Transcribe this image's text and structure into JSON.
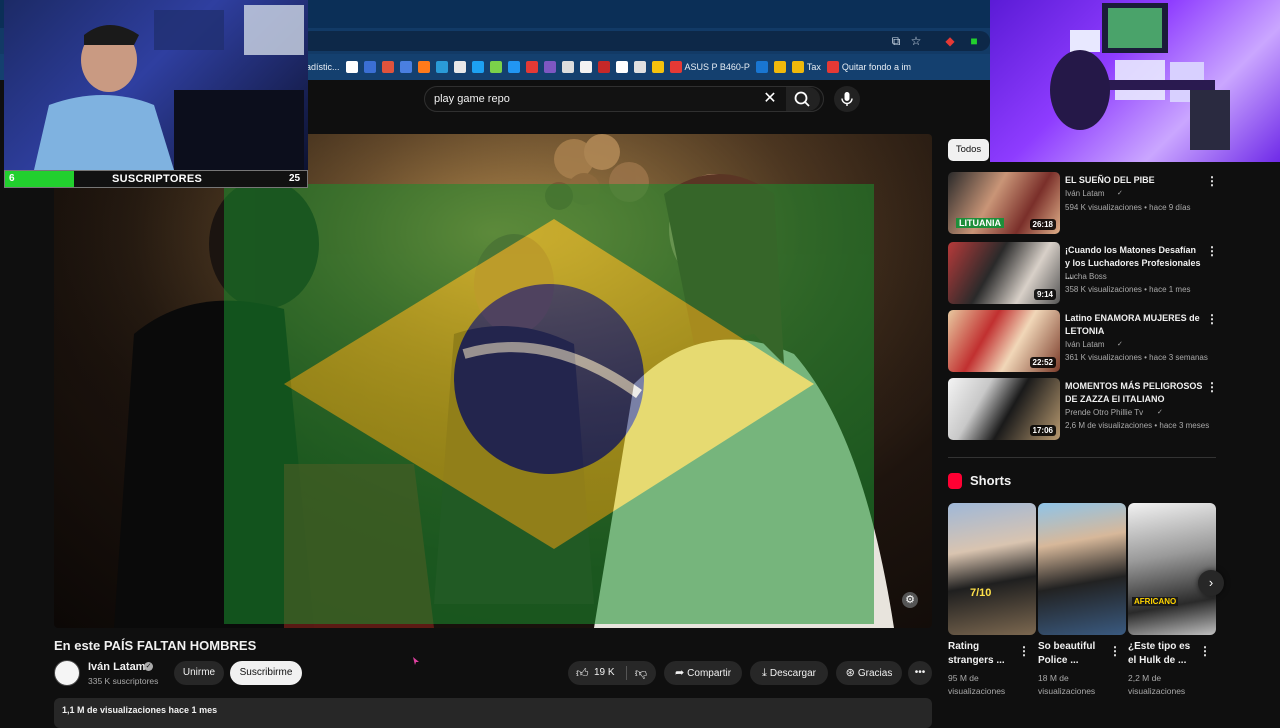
{
  "bookmarks": [
    {
      "label": "adístic...",
      "color": "#3a78d6"
    },
    {
      "label": "",
      "color": "#ffffff"
    },
    {
      "label": "",
      "color": "#3b6fd4"
    },
    {
      "label": "",
      "color": "#e0533c"
    },
    {
      "label": "",
      "color": "#4a7fe0"
    },
    {
      "label": "",
      "color": "#ff7a1a"
    },
    {
      "label": "",
      "color": "#2a9bd8"
    },
    {
      "label": "",
      "color": "#e8e8e8"
    },
    {
      "label": "",
      "color": "#1da1f2"
    },
    {
      "label": "",
      "color": "#7bd14a"
    },
    {
      "label": "",
      "color": "#2196f3"
    },
    {
      "label": "",
      "color": "#e53935"
    },
    {
      "label": "",
      "color": "#7e57c2"
    },
    {
      "label": "",
      "color": "#dddddd"
    },
    {
      "label": "",
      "color": "#f2f2f2"
    },
    {
      "label": "",
      "color": "#c62828"
    },
    {
      "label": "",
      "color": "#ffffff"
    },
    {
      "label": "",
      "color": "#e0e0e0"
    },
    {
      "label": "",
      "color": "#f4c20d"
    },
    {
      "label": "ASUS P B460-P",
      "color": "#e53935"
    },
    {
      "label": "",
      "color": "#1976d2"
    },
    {
      "label": "",
      "color": "#f0b90b"
    },
    {
      "label": "Tax",
      "color": "#f0b90b"
    },
    {
      "label": "Quitar fondo a im",
      "color": "#e53935"
    }
  ],
  "search": {
    "query": "play game repo"
  },
  "overlay": {
    "sub_left": "6",
    "sub_label": "SUSCRIPTORES",
    "sub_right": "25"
  },
  "video": {
    "title": "En este PAÍS FALTAN HOMBRES",
    "channel": "Iván Latam",
    "channel_subs": "335 K suscriptores",
    "join_label": "Unirme",
    "subscribe_label": "Suscribirme",
    "likes": "19 K",
    "share_label": "Compartir",
    "download_label": "Descargar",
    "thanks_label": "Gracias",
    "stats": "1,1 M de visualizaciones  hace 1 mes"
  },
  "sidebar": {
    "chip": "Todos",
    "recommendations": [
      {
        "title": "EL SUEÑO DEL PIBE",
        "channel": "Iván Latam",
        "verified": true,
        "meta": "594 K visualizaciones • hace 9 días",
        "duration": "26:18"
      },
      {
        "title": "¡Cuando los Matones Desafían y los Luchadores Profesionales ...",
        "channel": "Lucha Boss",
        "verified": false,
        "meta": "358 K visualizaciones • hace 1 mes",
        "duration": "9:14"
      },
      {
        "title": "Latino ENAMORA MUJERES de LETONIA",
        "channel": "Iván Latam",
        "verified": true,
        "meta": "361 K visualizaciones • hace 3 semanas",
        "duration": "22:52"
      },
      {
        "title": "MOMENTOS MÁS PELIGROSOS DE ZAZZA El ITALIANO",
        "channel": "Prende Otro Phillie Tv",
        "verified": true,
        "meta": "2,6 M de visualizaciones • hace 3 meses",
        "duration": "17:06"
      }
    ],
    "shorts_title": "Shorts",
    "shorts": [
      {
        "caption": "Rating strangers ...",
        "views_line1": "95 M de",
        "views_line2": "visualizaciones"
      },
      {
        "caption": "So beautiful Police ...",
        "views_line1": "18 M de",
        "views_line2": "visualizaciones"
      },
      {
        "caption": "¿Este tipo es el Hulk de ...",
        "views_line1": "2,2 M de",
        "views_line2": "visualizaciones"
      }
    ]
  },
  "colors": {
    "bg": "#0f0f0f",
    "accent_red": "#ff0033",
    "subscriber_bar": "#22d02e"
  }
}
